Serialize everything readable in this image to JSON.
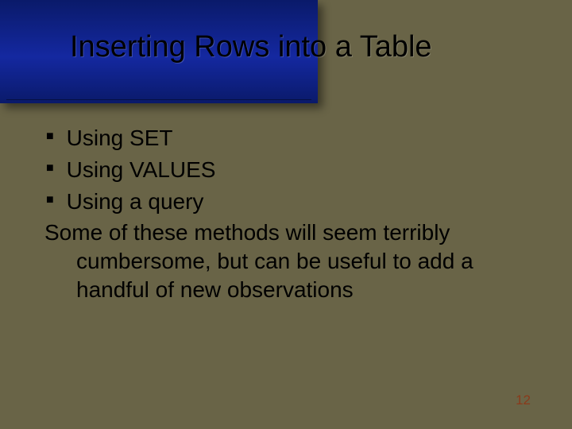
{
  "title": "Inserting Rows into a Table",
  "bullets": [
    "Using SET",
    "Using VALUES",
    "Using a query"
  ],
  "paragraph_line1": "Some of these methods will seem terribly",
  "paragraph_line2": "cumbersome, but can be useful to add a",
  "paragraph_line3": "handful of new observations",
  "page_number": "12"
}
